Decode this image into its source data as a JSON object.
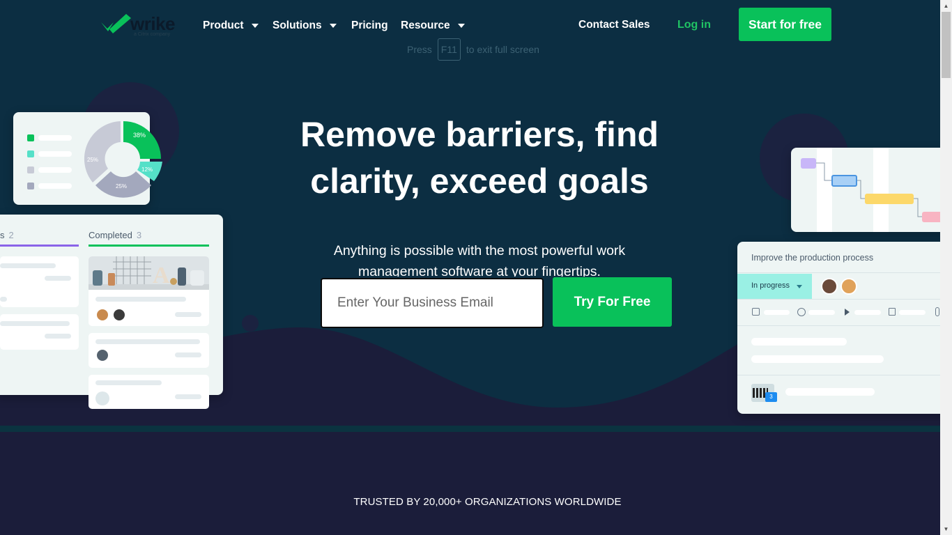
{
  "header": {
    "logo_text": "wrike",
    "logo_sub": "a Citrix company",
    "nav": [
      {
        "label": "Product",
        "has_dropdown": true
      },
      {
        "label": "Solutions",
        "has_dropdown": true
      },
      {
        "label": "Pricing",
        "has_dropdown": false
      },
      {
        "label": "Resource",
        "has_dropdown": true
      }
    ],
    "contact_label": "Contact Sales",
    "login_label": "Log in",
    "start_label": "Start for free"
  },
  "fullscreen_hint": {
    "before": "Press",
    "key": "F11",
    "after": "to exit full screen"
  },
  "hero": {
    "headline": "Remove barriers, find clarity, exceed goals",
    "subline": "Anything is possible with the most powerful work management software at your fingertips.",
    "email_placeholder": "Enter Your Business Email",
    "cta_label": "Try For Free"
  },
  "trusted": "TRUSTED BY 20,000+ ORGANIZATIONS WORLDWIDE",
  "left_chart_card": {
    "slices": [
      "38%",
      "12%",
      "25%",
      "25%"
    ],
    "colors": [
      "#09c15a",
      "#55e0c8",
      "#a3a8bd",
      "#c7cad6"
    ]
  },
  "board_card": {
    "column_a": {
      "label": "s",
      "count": "2"
    },
    "column_b": {
      "label": "Completed",
      "count": "3"
    }
  },
  "right_task_card": {
    "title": "Improve the production process",
    "status": "In progress",
    "comment_count": "3"
  },
  "colors": {
    "brand_green": "#09c15a",
    "background": "#0c2e42",
    "wave": "#1b1d3a"
  }
}
